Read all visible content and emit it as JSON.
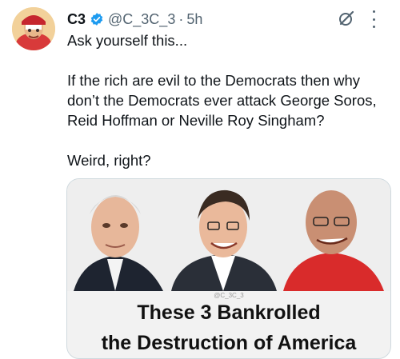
{
  "tweet": {
    "author_name": "C3",
    "handle": "@C_3C_3",
    "separator": "·",
    "time": "5h",
    "text_lines": [
      "Ask yourself this...",
      "",
      "If the rich are evil to the Democrats then why don’t the Democrats ever attack George Soros, Reid Hoffman or Neville Roy Singham?",
      "",
      "Weird, right?"
    ],
    "icons": {
      "avatar": "avatar",
      "verified": "verified-badge-icon",
      "grok": "grok-icon",
      "more": "more-options-icon"
    },
    "colors": {
      "verified": "#1d9bf0",
      "secondary_text": "#536471",
      "border": "#cfd9de"
    }
  },
  "media": {
    "watermark": "@C_3C_3",
    "headline_line1": "These 3 Bankrolled",
    "headline_line2": "the Destruction of America"
  }
}
